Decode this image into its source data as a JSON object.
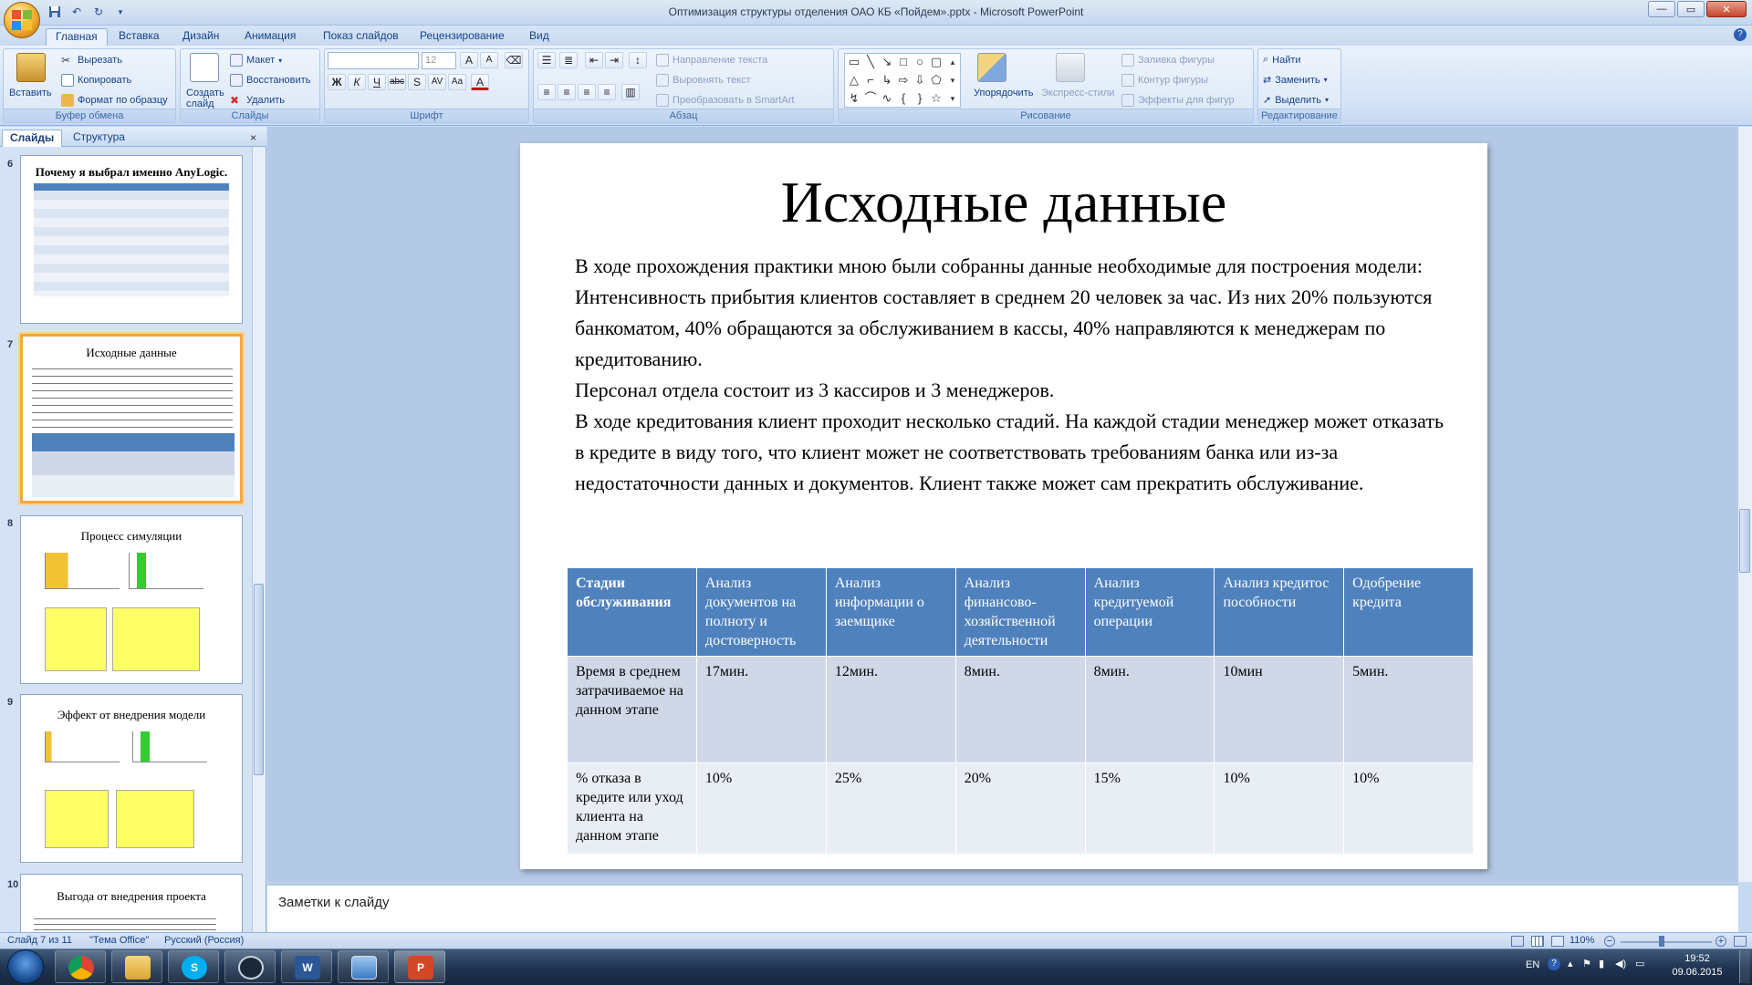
{
  "window": {
    "title": "Оптимизация структуры отделения ОАО КБ «Пойдем».pptx - Microsoft PowerPoint",
    "controls": [
      "minimize",
      "maximize",
      "close"
    ]
  },
  "ribbon_tabs": [
    "Главная",
    "Вставка",
    "Дизайн",
    "Анимация",
    "Показ слайдов",
    "Рецензирование",
    "Вид"
  ],
  "ribbon": {
    "clipboard": {
      "label": "Буфер обмена",
      "paste": "Вставить",
      "cut": "Вырезать",
      "copy": "Копировать",
      "format_painter": "Формат по образцу"
    },
    "slides": {
      "label": "Слайды",
      "new_slide": "Создать слайд",
      "layout": "Макет",
      "reset": "Восстановить",
      "delete": "Удалить"
    },
    "font": {
      "label": "Шрифт",
      "font_name": "",
      "font_size": "12"
    },
    "paragraph": {
      "label": "Абзац",
      "text_direction": "Направление текста",
      "align_text": "Выровнять текст",
      "smartart": "Преобразовать в SmartArt"
    },
    "drawing": {
      "label": "Рисование",
      "arrange": "Упорядочить",
      "quick_styles": "Экспресс-стили",
      "shape_fill": "Заливка фигуры",
      "shape_outline": "Контур фигуры",
      "shape_effects": "Эффекты для фигур"
    },
    "editing": {
      "label": "Редактирование",
      "find": "Найти",
      "replace": "Заменить",
      "select": "Выделить"
    }
  },
  "left_pane": {
    "tabs": [
      "Слайды",
      "Структура"
    ],
    "close_glyph": "×",
    "thumbnails": [
      {
        "num": "6",
        "title": "Почему я выбрал именно AnyLogic."
      },
      {
        "num": "7",
        "title": "Исходные данные"
      },
      {
        "num": "8",
        "title": "Процесс симуляции"
      },
      {
        "num": "9",
        "title": "Эффект от внедрения модели"
      },
      {
        "num": "10",
        "title": "Выгода от внедрения проекта"
      }
    ]
  },
  "slide": {
    "title": "Исходные данные",
    "paragraphs": [
      "В ходе прохождения практики мною были собранны данные необходимые для построения модели:",
      "Интенсивность прибытия клиентов составляет в среднем 20 человек за час. Из них 20% пользуются банкоматом, 40% обращаются за обслуживанием в кассы, 40% направляются к менеджерам по кредитованию.",
      "Персонал отдела состоит из 3 кассиров и 3 менеджеров.",
      "В ходе кредитования клиент проходит несколько стадий. На каждой стадии менеджер может отказать в кредите в виду того, что клиент может не соответствовать требованиям банка или из-за недостаточности данных и документов. Клиент также может сам прекратить обслуживание."
    ],
    "table": {
      "headers": [
        "Стадии обслуживания",
        "Анализ документов на полноту и достоверность",
        "Анализ информации о заемщике",
        "Анализ финансово-хозяйственной деятельности",
        "Анализ кредитуемой операции",
        "Анализ кредитоспособности",
        "Одобрение кредита"
      ],
      "rows": [
        [
          "Время в среднем затрачиваемое на данном этапе",
          "17мин.",
          "12мин.",
          "8мин.",
          "8мин.",
          "10мин",
          "5мин."
        ],
        [
          "% отказа в кредите или уход клиента на данном этапе",
          "10%",
          "25%",
          "20%",
          "15%",
          "10%",
          "10%"
        ]
      ]
    }
  },
  "notes": {
    "placeholder": "Заметки к слайду"
  },
  "status_bar": {
    "slide_info": "Слайд 7 из 11",
    "theme": "\"Тема Office\"",
    "language": "Русский (Россия)",
    "zoom": "110%"
  },
  "taskbar": {
    "apps": [
      "chrome-icon",
      "explorer-icon",
      "skype-icon",
      "steam-icon",
      "word-icon",
      "desktop-icon",
      "powerpoint-icon"
    ],
    "language": "EN",
    "time": "19:52",
    "date": "09.06.2015"
  },
  "colors": {
    "table_header": "#4f81bd",
    "table_row1": "#d0d8e8",
    "table_row2": "#e9edf4",
    "selection": "#f4a640"
  }
}
